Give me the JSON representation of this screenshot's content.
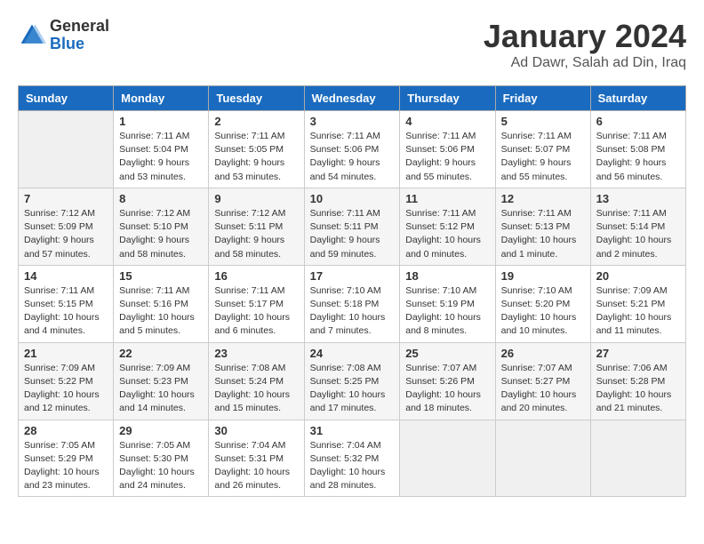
{
  "logo": {
    "general": "General",
    "blue": "Blue"
  },
  "title": "January 2024",
  "subtitle": "Ad Dawr, Salah ad Din, Iraq",
  "days_header": [
    "Sunday",
    "Monday",
    "Tuesday",
    "Wednesday",
    "Thursday",
    "Friday",
    "Saturday"
  ],
  "weeks": [
    [
      {
        "num": "",
        "sunrise": "",
        "sunset": "",
        "daylight": ""
      },
      {
        "num": "1",
        "sunrise": "Sunrise: 7:11 AM",
        "sunset": "Sunset: 5:04 PM",
        "daylight": "Daylight: 9 hours and 53 minutes."
      },
      {
        "num": "2",
        "sunrise": "Sunrise: 7:11 AM",
        "sunset": "Sunset: 5:05 PM",
        "daylight": "Daylight: 9 hours and 53 minutes."
      },
      {
        "num": "3",
        "sunrise": "Sunrise: 7:11 AM",
        "sunset": "Sunset: 5:06 PM",
        "daylight": "Daylight: 9 hours and 54 minutes."
      },
      {
        "num": "4",
        "sunrise": "Sunrise: 7:11 AM",
        "sunset": "Sunset: 5:06 PM",
        "daylight": "Daylight: 9 hours and 55 minutes."
      },
      {
        "num": "5",
        "sunrise": "Sunrise: 7:11 AM",
        "sunset": "Sunset: 5:07 PM",
        "daylight": "Daylight: 9 hours and 55 minutes."
      },
      {
        "num": "6",
        "sunrise": "Sunrise: 7:11 AM",
        "sunset": "Sunset: 5:08 PM",
        "daylight": "Daylight: 9 hours and 56 minutes."
      }
    ],
    [
      {
        "num": "7",
        "sunrise": "Sunrise: 7:12 AM",
        "sunset": "Sunset: 5:09 PM",
        "daylight": "Daylight: 9 hours and 57 minutes."
      },
      {
        "num": "8",
        "sunrise": "Sunrise: 7:12 AM",
        "sunset": "Sunset: 5:10 PM",
        "daylight": "Daylight: 9 hours and 58 minutes."
      },
      {
        "num": "9",
        "sunrise": "Sunrise: 7:12 AM",
        "sunset": "Sunset: 5:11 PM",
        "daylight": "Daylight: 9 hours and 58 minutes."
      },
      {
        "num": "10",
        "sunrise": "Sunrise: 7:11 AM",
        "sunset": "Sunset: 5:11 PM",
        "daylight": "Daylight: 9 hours and 59 minutes."
      },
      {
        "num": "11",
        "sunrise": "Sunrise: 7:11 AM",
        "sunset": "Sunset: 5:12 PM",
        "daylight": "Daylight: 10 hours and 0 minutes."
      },
      {
        "num": "12",
        "sunrise": "Sunrise: 7:11 AM",
        "sunset": "Sunset: 5:13 PM",
        "daylight": "Daylight: 10 hours and 1 minute."
      },
      {
        "num": "13",
        "sunrise": "Sunrise: 7:11 AM",
        "sunset": "Sunset: 5:14 PM",
        "daylight": "Daylight: 10 hours and 2 minutes."
      }
    ],
    [
      {
        "num": "14",
        "sunrise": "Sunrise: 7:11 AM",
        "sunset": "Sunset: 5:15 PM",
        "daylight": "Daylight: 10 hours and 4 minutes."
      },
      {
        "num": "15",
        "sunrise": "Sunrise: 7:11 AM",
        "sunset": "Sunset: 5:16 PM",
        "daylight": "Daylight: 10 hours and 5 minutes."
      },
      {
        "num": "16",
        "sunrise": "Sunrise: 7:11 AM",
        "sunset": "Sunset: 5:17 PM",
        "daylight": "Daylight: 10 hours and 6 minutes."
      },
      {
        "num": "17",
        "sunrise": "Sunrise: 7:10 AM",
        "sunset": "Sunset: 5:18 PM",
        "daylight": "Daylight: 10 hours and 7 minutes."
      },
      {
        "num": "18",
        "sunrise": "Sunrise: 7:10 AM",
        "sunset": "Sunset: 5:19 PM",
        "daylight": "Daylight: 10 hours and 8 minutes."
      },
      {
        "num": "19",
        "sunrise": "Sunrise: 7:10 AM",
        "sunset": "Sunset: 5:20 PM",
        "daylight": "Daylight: 10 hours and 10 minutes."
      },
      {
        "num": "20",
        "sunrise": "Sunrise: 7:09 AM",
        "sunset": "Sunset: 5:21 PM",
        "daylight": "Daylight: 10 hours and 11 minutes."
      }
    ],
    [
      {
        "num": "21",
        "sunrise": "Sunrise: 7:09 AM",
        "sunset": "Sunset: 5:22 PM",
        "daylight": "Daylight: 10 hours and 12 minutes."
      },
      {
        "num": "22",
        "sunrise": "Sunrise: 7:09 AM",
        "sunset": "Sunset: 5:23 PM",
        "daylight": "Daylight: 10 hours and 14 minutes."
      },
      {
        "num": "23",
        "sunrise": "Sunrise: 7:08 AM",
        "sunset": "Sunset: 5:24 PM",
        "daylight": "Daylight: 10 hours and 15 minutes."
      },
      {
        "num": "24",
        "sunrise": "Sunrise: 7:08 AM",
        "sunset": "Sunset: 5:25 PM",
        "daylight": "Daylight: 10 hours and 17 minutes."
      },
      {
        "num": "25",
        "sunrise": "Sunrise: 7:07 AM",
        "sunset": "Sunset: 5:26 PM",
        "daylight": "Daylight: 10 hours and 18 minutes."
      },
      {
        "num": "26",
        "sunrise": "Sunrise: 7:07 AM",
        "sunset": "Sunset: 5:27 PM",
        "daylight": "Daylight: 10 hours and 20 minutes."
      },
      {
        "num": "27",
        "sunrise": "Sunrise: 7:06 AM",
        "sunset": "Sunset: 5:28 PM",
        "daylight": "Daylight: 10 hours and 21 minutes."
      }
    ],
    [
      {
        "num": "28",
        "sunrise": "Sunrise: 7:05 AM",
        "sunset": "Sunset: 5:29 PM",
        "daylight": "Daylight: 10 hours and 23 minutes."
      },
      {
        "num": "29",
        "sunrise": "Sunrise: 7:05 AM",
        "sunset": "Sunset: 5:30 PM",
        "daylight": "Daylight: 10 hours and 24 minutes."
      },
      {
        "num": "30",
        "sunrise": "Sunrise: 7:04 AM",
        "sunset": "Sunset: 5:31 PM",
        "daylight": "Daylight: 10 hours and 26 minutes."
      },
      {
        "num": "31",
        "sunrise": "Sunrise: 7:04 AM",
        "sunset": "Sunset: 5:32 PM",
        "daylight": "Daylight: 10 hours and 28 minutes."
      },
      {
        "num": "",
        "sunrise": "",
        "sunset": "",
        "daylight": ""
      },
      {
        "num": "",
        "sunrise": "",
        "sunset": "",
        "daylight": ""
      },
      {
        "num": "",
        "sunrise": "",
        "sunset": "",
        "daylight": ""
      }
    ]
  ]
}
